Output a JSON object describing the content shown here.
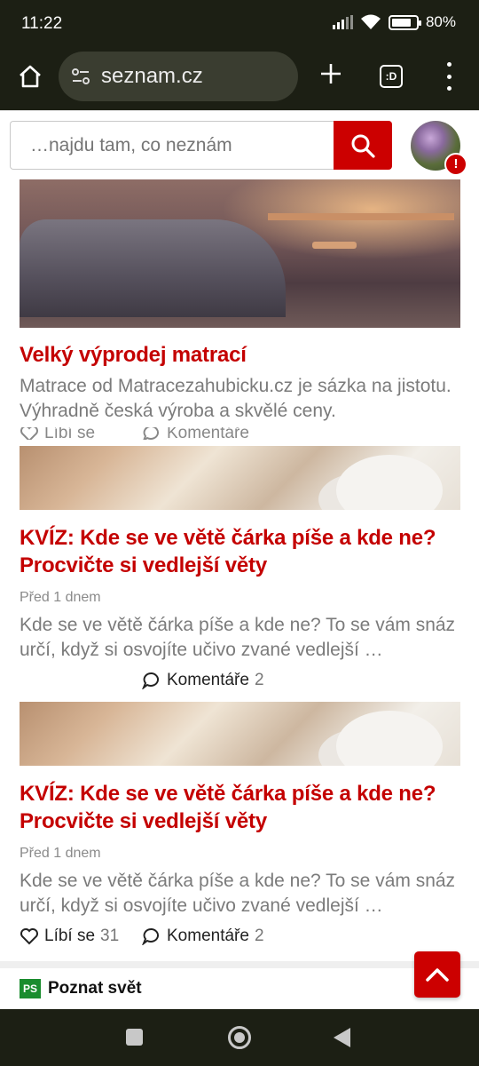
{
  "status_bar": {
    "time": "11:22",
    "battery": "80%",
    "battery_level": 0.8,
    "icons": [
      "signal-icon",
      "wifi-icon",
      "battery-icon"
    ]
  },
  "browser": {
    "url": "seznam.cz",
    "tab_indicator": ":D",
    "icons": [
      "home-icon",
      "site-settings-icon",
      "new-tab-icon",
      "tab-switcher-icon",
      "more-menu-icon"
    ]
  },
  "header": {
    "search_placeholder": "…najdu tam, co neznám",
    "alert_badge": "!",
    "accent_color": "#cc0000"
  },
  "articles": [
    {
      "title": "Velký výprodej matrací",
      "perex": "Matrace od Matracezahubicku.cz je sázka na jistotu. Výhradně česká výroba a skvělé ceny.",
      "like_label": "Líbí se",
      "comments_label": "Komentáře"
    },
    {
      "title": "KVÍZ: Kde se ve větě čárka píše a kde ne? Procvičte si vedlejší věty",
      "date": "Před 1 dnem",
      "perex": "Kde se ve větě čárka píše a kde ne? To se vám snáz určí, když si osvojíte učivo zvané vedlejší …",
      "comments_label": "Komentáře",
      "comments_count": "2"
    },
    {
      "title": "KVÍZ: Kde se ve větě čárka píše a kde ne? Procvičte si vedlejší věty",
      "date": "Před 1 dnem",
      "perex": "Kde se ve větě čárka píše a kde ne? To se vám snáz určí, když si osvojíte učivo zvané vedlejší …",
      "like_label": "Líbí se",
      "like_count": "31",
      "comments_label": "Komentáře",
      "comments_count": "2"
    }
  ],
  "section": {
    "logo": "PS",
    "title": "Poznat svět"
  }
}
